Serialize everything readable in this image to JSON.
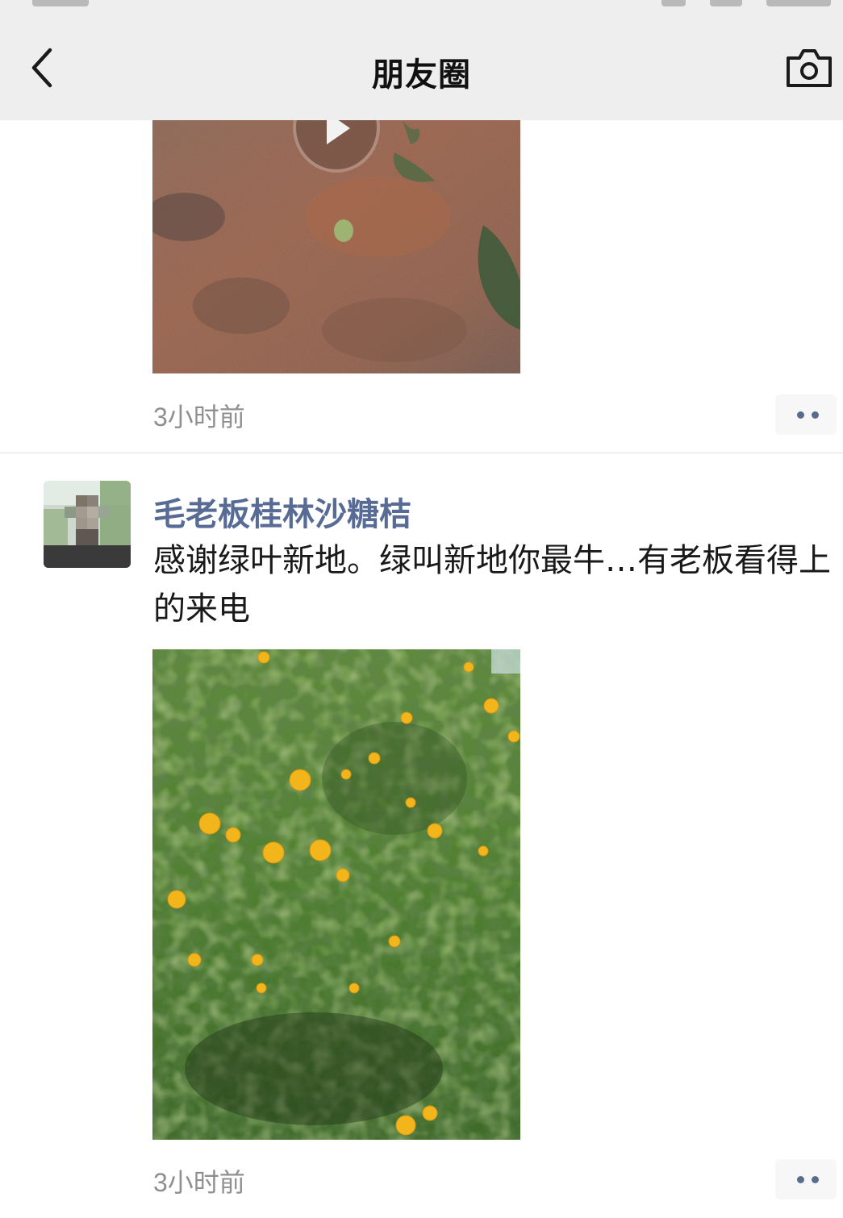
{
  "navbar": {
    "title": "朋友圈",
    "back_icon": "chevron-left-icon",
    "camera_icon": "camera-icon"
  },
  "posts": [
    {
      "media_type": "video",
      "media_icon": "play-icon",
      "timestamp": "3小时前",
      "more_icon": "more-dots-icon"
    },
    {
      "author": "毛老板桂林沙糖桔",
      "text": "感谢绿叶新地。绿叫新地你最牛…有老板看得上的来电",
      "media_type": "video",
      "timestamp": "3小时前",
      "more_icon": "more-dots-icon"
    }
  ],
  "colors": {
    "navbar_bg": "#eeeeee",
    "author_name": "#576b95",
    "timestamp": "#8f8f8f",
    "text": "#191919"
  }
}
